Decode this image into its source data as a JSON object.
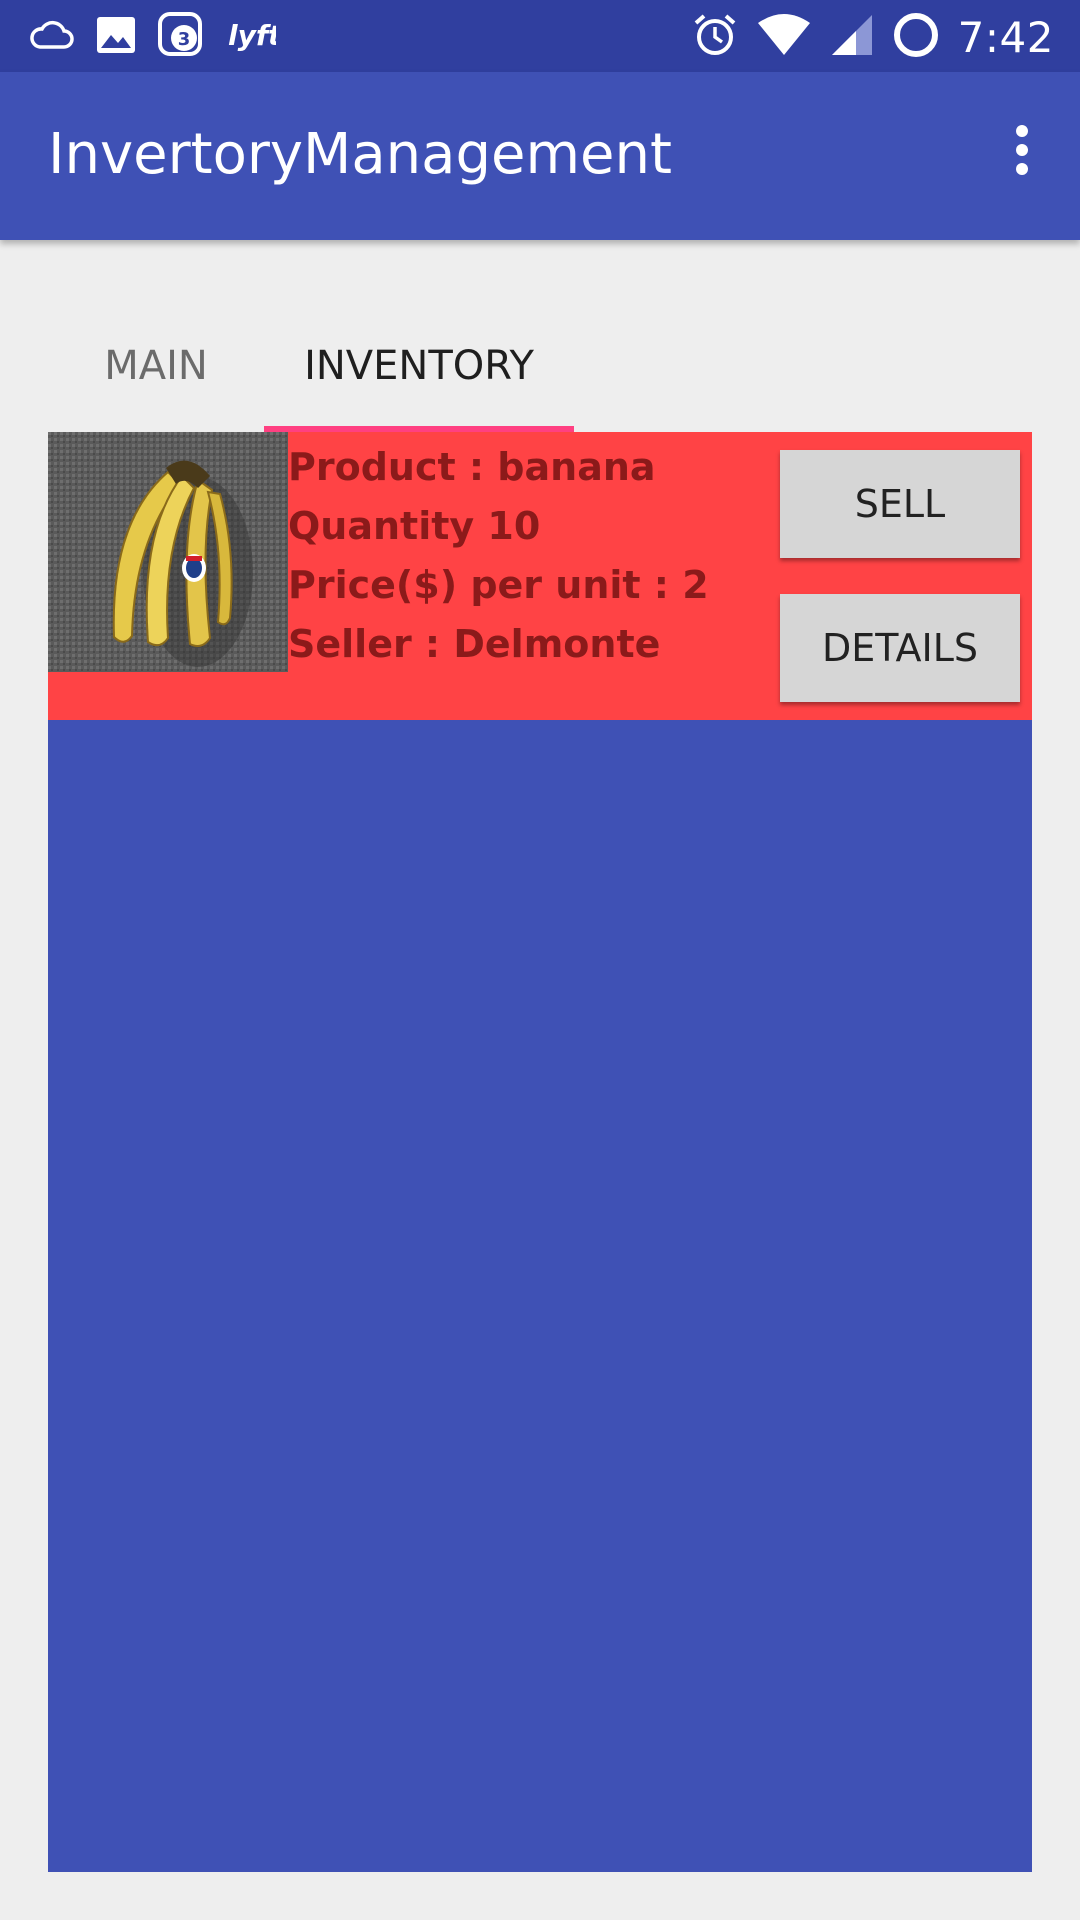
{
  "status_bar": {
    "time": "7:42",
    "notification_badge": "3",
    "left_icons": [
      "cloud-icon",
      "image-icon",
      "badge-app-icon",
      "lyft-icon"
    ],
    "lyft_text": "lyft",
    "right_icons": [
      "alarm-icon",
      "wifi-icon",
      "cell-signal-icon",
      "ring-icon"
    ]
  },
  "app_bar": {
    "title": "InvertoryManagement",
    "overflow_icon": "more-vert-icon"
  },
  "tabs": [
    {
      "label": "MAIN",
      "selected": false
    },
    {
      "label": "INVENTORY",
      "selected": true
    }
  ],
  "products": [
    {
      "image_icon": "banana-image",
      "product_line": "Product : banana",
      "quantity_line": "Quantity 10",
      "price_line": "Price($) per unit : 2",
      "seller_line": "Seller : Delmonte",
      "sell_label": "SELL",
      "details_label": "DETAILS"
    }
  ],
  "colors": {
    "status_bar": "#303f9f",
    "app_bar": "#3f51b5",
    "tab_indicator": "#ff4081",
    "row_background": "#ff4345",
    "row_text": "#8b1a1a",
    "list_background": "#3f51b5",
    "page_background": "#eeeeee",
    "button": "#d6d6d6"
  }
}
